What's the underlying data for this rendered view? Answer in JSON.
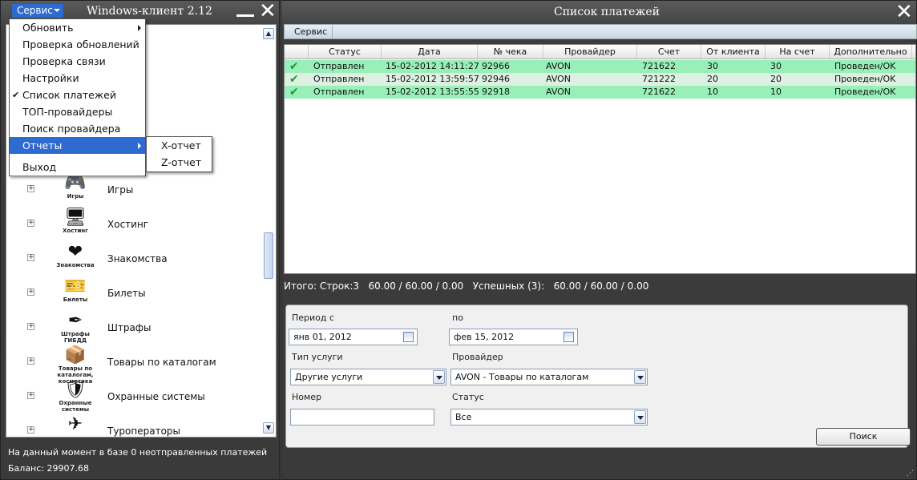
{
  "left_window": {
    "title": "Windows-клиент 2.12",
    "menu_button": "Сервис",
    "dropdown": [
      {
        "label": "Обновить",
        "submenu": true
      },
      {
        "label": "Проверка обновлений"
      },
      {
        "label": "Проверка связи"
      },
      {
        "label": "Настройки"
      },
      {
        "label": "Список платежей",
        "checked": true
      },
      {
        "label": "ТОП-провайдеры"
      },
      {
        "label": "Поиск провайдера"
      },
      {
        "label": "Отчеты",
        "submenu": true,
        "highlighted": true
      },
      {
        "label": "Выход"
      }
    ],
    "check_mark": "✔",
    "submenu": [
      "X-отчет",
      "Z-отчет"
    ],
    "categories": [
      {
        "label": "Игры",
        "caption": "Игры",
        "icon": "gamepad-icon",
        "glyph": "🎮"
      },
      {
        "label": "Хостинг",
        "caption": "Хостинг",
        "icon": "server-icon",
        "glyph": "🖥"
      },
      {
        "label": "Знакомства",
        "caption": "Знакомства",
        "icon": "heart-icon",
        "glyph": "❤"
      },
      {
        "label": "Билеты",
        "caption": "Билеты",
        "icon": "ticket-icon",
        "glyph": "🎫"
      },
      {
        "label": "Штрафы",
        "caption": "Штрафы ГИБДД",
        "icon": "pen-icon",
        "glyph": "✒"
      },
      {
        "label": "Товары по каталогам",
        "caption": "Товары по каталогам, косметика",
        "icon": "catalog-icon",
        "glyph": "📦"
      },
      {
        "label": "Охранные системы",
        "caption": "Охранные системы",
        "icon": "shield-icon",
        "glyph": "🛡"
      },
      {
        "label": "Туроператоры",
        "caption": "",
        "icon": "plane-icon",
        "glyph": "✈"
      }
    ],
    "status_line": "На данный момент в базе 0 неотправленных платежей",
    "balance": "Баланс: 29907.68"
  },
  "right_window": {
    "title": "Список платежей",
    "toolbar_button": "Сервис",
    "table": {
      "columns": [
        "Статус",
        "Дата",
        "№ чека",
        "Провайдер",
        "Счет",
        "От клиента",
        "На счет",
        "Дополнительно"
      ],
      "rows": [
        {
          "status": "Отправлен",
          "date": "15-02-2012 14:11:27",
          "receipt": "92966",
          "provider": "AVON",
          "account": "721622",
          "from_client": "30",
          "to_account": "30",
          "extra": "Проведен/OK"
        },
        {
          "status": "Отправлен",
          "date": "15-02-2012 13:59:57",
          "receipt": "92946",
          "provider": "AVON",
          "account": "721222",
          "from_client": "20",
          "to_account": "20",
          "extra": "Проведен/OK"
        },
        {
          "status": "Отправлен",
          "date": "15-02-2012 13:55:55",
          "receipt": "92918",
          "provider": "AVON",
          "account": "721622",
          "from_client": "10",
          "to_account": "10",
          "extra": "Проведен/OK"
        }
      ]
    },
    "totals": "Итого: Строк:3   60.00 / 60.00 / 0.00   Успешных (3):   60.00 / 60.00 / 0.00",
    "filter": {
      "period_from_label": "Период с",
      "period_to_label": "по",
      "date_from": "янв 01, 2012",
      "date_to": "фев 15, 2012",
      "service_type_label": "Тип услуги",
      "service_type": "Другие услуги",
      "provider_label": "Провайдер",
      "provider": "AVON - Товары по каталогам",
      "number_label": "Номер",
      "number": "",
      "status_label": "Статус",
      "status": "Все",
      "search_button": "Поиск"
    }
  },
  "colors": {
    "menu_blue": "#2e6bd0",
    "row_green": "#98f0b8",
    "row_light": "#ddf0e2",
    "ok_green": "#1a9a2c"
  }
}
